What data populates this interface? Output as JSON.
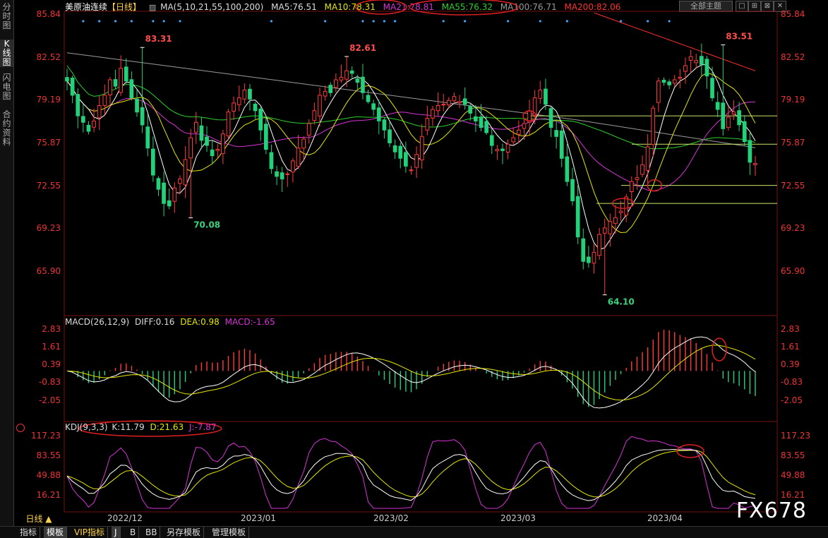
{
  "left_tabs": [
    "分时图",
    "K线图",
    "闪电图",
    "合约资料"
  ],
  "header": {
    "title": "美原油连续",
    "period": "【日线】",
    "ma_params": "MA(5,10,21,55,100,200)",
    "ma5": "MA5:76.51",
    "ma10": "MA10:78.31",
    "ma21": "MA21:78.81",
    "ma55": "MA55:76.32",
    "ma100": "MA100:76.71",
    "ma200": "MA200:82.06",
    "settings_select": "全部主题",
    "window_buttons": [
      "□",
      "⊞",
      "⊠",
      "✕"
    ]
  },
  "colors": {
    "up": "#ff3b3b",
    "down": "#22d17a",
    "ma5": "#ffffff",
    "ma10": "#e6e600",
    "ma21": "#d633d6",
    "ma55": "#2ad12a",
    "ma100": "#9a9a9a",
    "ma200": "#ff3030",
    "axis": "#ee3333"
  },
  "chart_data": [
    {
      "type": "candlestick",
      "title": "美原油连续【日线】",
      "y_ticks": [
        "85.84",
        "82.52",
        "79.19",
        "75.87",
        "72.55",
        "69.23",
        "65.90"
      ],
      "ylim": [
        62.6,
        85.9
      ],
      "x_tick_labels": [
        "2022/12",
        "2023/01",
        "2023/02",
        "2023/03",
        "2023/04"
      ],
      "annotations": {
        "high_1": "83.31",
        "high_2": "82.61",
        "high_3": "83.51",
        "low_1": "70.08",
        "low_2": "64.10"
      },
      "horizontal_lines": [
        77.9,
        75.8,
        72.6,
        71.2
      ],
      "close": [
        80.7,
        79.6,
        78.0,
        77.5,
        76.8,
        77.6,
        78.8,
        79.6,
        80.8,
        80.3,
        81.7,
        80.7,
        79.4,
        78.3,
        77.3,
        75.5,
        73.4,
        72.3,
        71.2,
        71.0,
        72.4,
        73.1,
        74.6,
        76.3,
        77.5,
        76.1,
        75.7,
        74.9,
        75.4,
        76.6,
        78.3,
        79.0,
        79.4,
        80.0,
        79.3,
        78.4,
        76.9,
        75.4,
        73.9,
        73.3,
        73.1,
        73.5,
        74.5,
        75.5,
        76.2,
        77.4,
        78.4,
        79.6,
        79.9,
        79.8,
        80.8,
        81.0,
        81.5,
        81.3,
        80.6,
        79.8,
        79.1,
        78.5,
        77.6,
        76.9,
        75.9,
        75.2,
        74.7,
        74.1,
        73.8,
        75.0,
        76.4,
        77.8,
        78.5,
        78.8,
        78.9,
        79.2,
        79.5,
        79.1,
        78.9,
        78.2,
        77.6,
        77.1,
        76.7,
        75.7,
        75.4,
        75.3,
        75.8,
        76.3,
        76.9,
        77.4,
        78.4,
        79.4,
        80.0,
        78.9,
        77.1,
        76.4,
        74.7,
        72.9,
        71.4,
        68.6,
        66.7,
        66.6,
        67.4,
        68.8,
        69.3,
        69.8,
        70.1,
        70.6,
        71.7,
        72.9,
        73.2,
        74.2,
        75.6,
        78.6,
        80.7,
        80.6,
        80.4,
        80.8,
        81.0,
        81.9,
        82.6,
        82.3,
        82.0,
        81.1,
        79.4,
        78.5,
        77.0,
        77.9,
        78.3,
        77.3,
        76.0,
        74.4,
        74.3
      ],
      "macd": {
        "title": "MACD(26,12,9)",
        "diff": "DIFF:0.16",
        "dea": "DEA:0.98",
        "macd": "MACD:-1.65",
        "y_ticks": [
          "2.83",
          "1.61",
          "0.39",
          "-0.83",
          "-2.05"
        ],
        "ylim": [
          -2.6,
          2.83
        ]
      },
      "kdj": {
        "title": "KDJ(9,3,3)",
        "k": "K:11.79",
        "d": "D:21.63",
        "j": "J:-7.87",
        "y_ticks": [
          "117.23",
          "83.55",
          "49.88",
          "16.21"
        ],
        "ylim": [
          -5,
          117.23
        ]
      }
    }
  ],
  "footer": {
    "period_select": "日线 ▲",
    "watermark": "FX678",
    "tabs": [
      "指标",
      "模板",
      "VIP指标",
      "J",
      "B",
      "BB",
      "另存模板",
      "管理模板"
    ]
  }
}
